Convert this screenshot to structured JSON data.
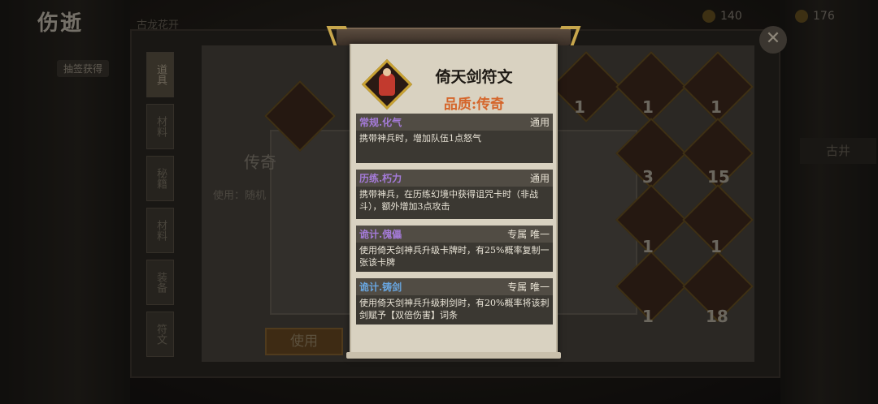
{
  "background": {
    "logo": "伤逝",
    "logo_sub": "抽签获得",
    "top_title": "古龙花开",
    "currency": [
      {
        "value": "140"
      },
      {
        "value": "176"
      }
    ],
    "close_glyph": "✕",
    "tabs": [
      {
        "label": "道具",
        "active": true
      },
      {
        "label": "材料",
        "active": false
      },
      {
        "label": "秘籍",
        "active": false
      },
      {
        "label": "材料",
        "active": false
      },
      {
        "label": "装备",
        "active": false
      },
      {
        "label": "符文",
        "active": false
      }
    ],
    "detail_title": "传奇",
    "detail_use": "使用：随机",
    "use_button": "使用",
    "right_button": "古井",
    "grid_numbers": [
      "1",
      "1",
      "1",
      "3",
      "15",
      "1",
      "1",
      "1",
      "18"
    ]
  },
  "tooltip": {
    "name": "倚天剑符文",
    "quality": "品质:传奇",
    "icon": "sword-rune-icon",
    "sections": [
      {
        "name": "常规.化气",
        "tag": "通用",
        "color": "purple",
        "desc": "携带神兵时，增加队伍1点怒气"
      },
      {
        "name": "历练.朽力",
        "tag": "通用",
        "color": "purple",
        "desc": "携带神兵，在历练幻境中获得诅咒卡时（非战斗），额外增加3点攻击"
      },
      {
        "name": "诡计.傀儡",
        "tag": "专属 唯一",
        "color": "purple",
        "desc": "使用倚天剑神兵升级卡牌时，有25%概率复制一张该卡牌"
      },
      {
        "name": "诡计.铸剑",
        "tag": "专属 唯一",
        "color": "blue",
        "desc": "使用倚天剑神兵升级刺剑时，有20%概率将该刺剑赋予【双倍伤害】词条"
      }
    ]
  },
  "colors": {
    "quality": "#d5652a",
    "section_purple": "#a57bd9",
    "section_blue": "#69a6e0",
    "paper": "#d9d2c1"
  }
}
